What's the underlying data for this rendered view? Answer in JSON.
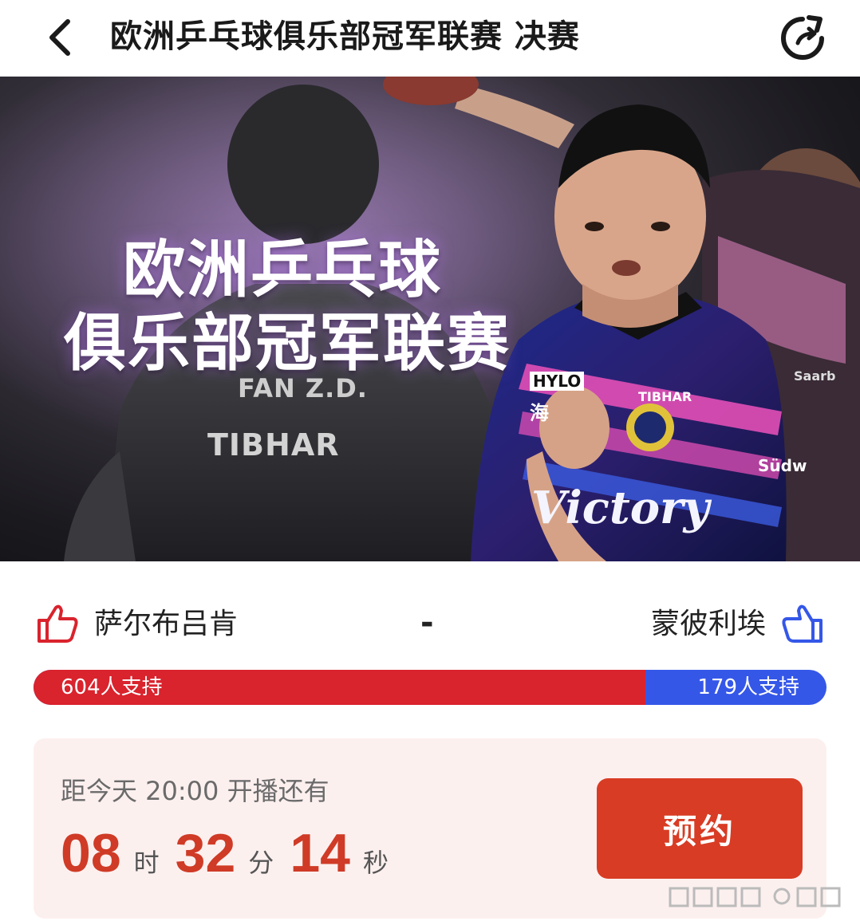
{
  "header": {
    "title": "欧洲乒乓球俱乐部冠军联赛 决赛",
    "back_icon": "chevron-left-icon",
    "refresh_icon": "refresh-icon"
  },
  "banner": {
    "title_line1": "欧洲乒乓球",
    "title_line2": "俱乐部冠军联赛",
    "jersey_name": "FAN Z.D.",
    "jersey_brand": "TIBHAR",
    "shirt_sponsor_1": "HYLO",
    "shirt_sponsor_2": "TIBHAR",
    "shirt_sponsor_3": "Victory",
    "shirt_sponsor_4": "Südw",
    "shirt_sponsor_5": "Saarb",
    "shirt_char": "海"
  },
  "match": {
    "team_left": "萨尔布吕肯",
    "score_separator": "-",
    "team_right": "蒙彼利埃",
    "left_thumb_icon": "thumbs-up-icon",
    "right_thumb_icon": "thumbs-up-icon"
  },
  "support": {
    "left_text": "604人支持",
    "right_text": "179人支持",
    "left_count": 604,
    "right_count": 179,
    "left_color": "#d9232d",
    "right_color": "#3557e8"
  },
  "countdown": {
    "label": "距今天 20:00 开播还有",
    "hours": "08",
    "hours_unit": "时",
    "minutes": "32",
    "minutes_unit": "分",
    "seconds": "14",
    "seconds_unit": "秒",
    "reserve_label": "预约",
    "accent_color": "#cf3b26"
  }
}
